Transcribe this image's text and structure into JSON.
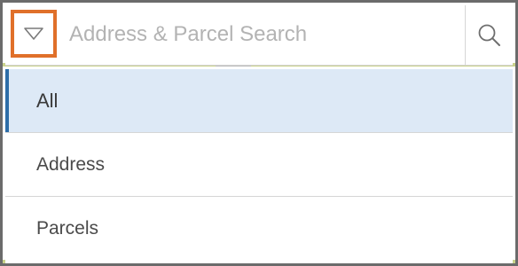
{
  "search": {
    "placeholder": "Address & Parcel Search",
    "value": "",
    "dropdown_icon": "triangle-down-outline-icon",
    "search_icon": "magnifier-icon"
  },
  "menu": {
    "items": [
      {
        "label": "All",
        "selected": true
      },
      {
        "label": "Address",
        "selected": false
      },
      {
        "label": "Parcels",
        "selected": false
      }
    ]
  },
  "colors": {
    "highlight_border": "#e0702a",
    "selected_bg": "#dde9f6",
    "selected_accent": "#2d6ea8"
  }
}
